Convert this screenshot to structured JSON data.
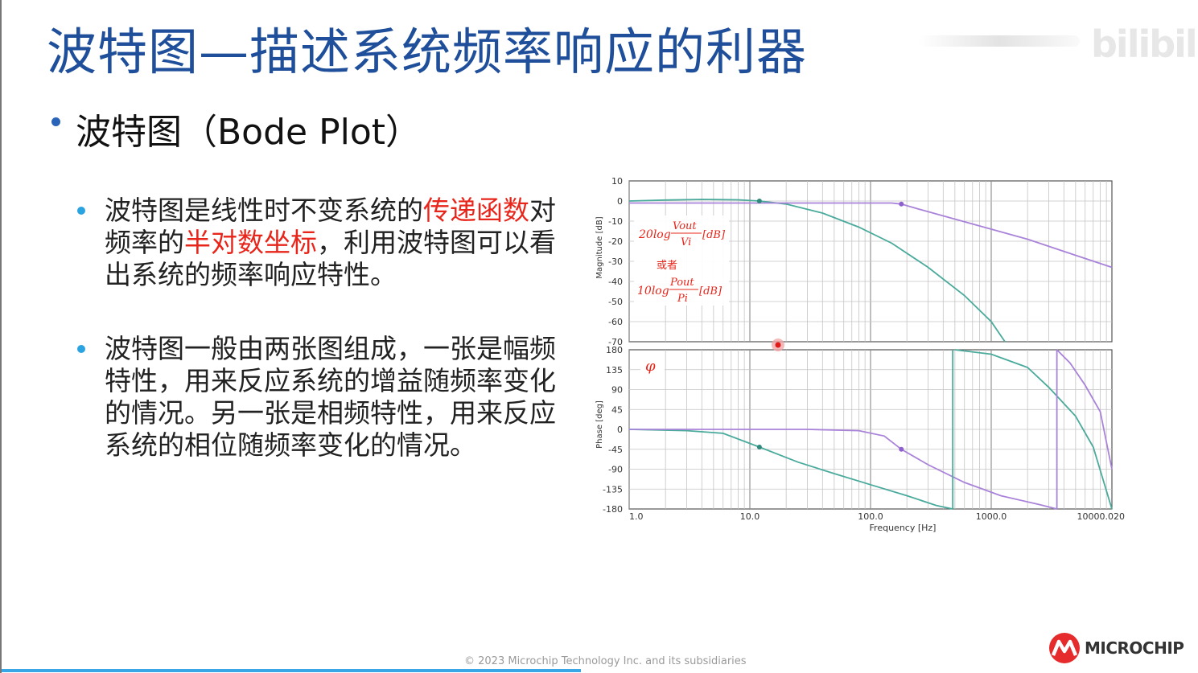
{
  "slide": {
    "title": "波特图—描述系统频率响应的利器",
    "watermark_logo": "bilibili",
    "subtitle": "波特图（Bode Plot）",
    "bullet1": {
      "part1": "波特图是线性时不变系统的",
      "part2": "传递函数",
      "part3": "对频率的",
      "part4": "半对数坐标",
      "part5": "，利用波特图可以看出系统的频率响应特性。"
    },
    "bullet2": "波特图一般由两张图组成，一张是幅频特性，用来反应系统的增益随频率变化的情况。另一张是相频特性，用来反应系统的相位随频率变化的情况。",
    "copyright": "© 2023 Microchip Technology Inc. and its subsidiaries",
    "brand": "MICROCHIP"
  },
  "colors": {
    "title": "#1f4f9a",
    "highlight": "#e8251a",
    "bullet_dot": "#2aa3e0",
    "series_teal": "#4aaa9c",
    "series_purple": "#a983d9",
    "brand_red": "#e52b2b"
  },
  "chart_data": {
    "type": "line",
    "xlabel": "Frequency [Hz]",
    "xscale": "log",
    "x_ticks": [
      "1.0",
      "10.0",
      "100.0",
      "1000.0",
      "10000.020"
    ],
    "xlim": [
      1,
      10000
    ],
    "magnitude": {
      "ylabel": "Magnitude [dB]",
      "ylim": [
        -70,
        10
      ],
      "y_ticks": [
        "10",
        "0",
        "-10",
        "-20",
        "-30",
        "-40",
        "-50",
        "-60",
        "-70"
      ],
      "annotation_1_prefix": "20log",
      "annotation_1_num": "Vout",
      "annotation_1_den": "Vi",
      "annotation_1_unit": "[dB]",
      "annotation_or": "或者",
      "annotation_2_prefix": "10log",
      "annotation_2_num": "Pout",
      "annotation_2_den": "Pi",
      "annotation_2_unit": "[dB]",
      "series": [
        {
          "x": [
            1,
            2,
            4,
            8,
            12,
            20,
            40,
            80,
            150,
            300,
            600,
            1000,
            1300
          ],
          "y": [
            0,
            0.5,
            0.8,
            0.6,
            0,
            -1.5,
            -6,
            -13,
            -21,
            -33,
            -47,
            -60,
            -70
          ]
        },
        {
          "x": [
            1,
            10,
            100,
            150,
            180,
            250,
            500,
            1000,
            2000,
            5000,
            10000
          ],
          "y": [
            -1,
            -1,
            -1,
            -1,
            -1.5,
            -4,
            -9,
            -14,
            -19,
            -27,
            -33
          ]
        }
      ],
      "markers": [
        {
          "x": 12,
          "y": 0
        },
        {
          "x": 180,
          "y": -1.5
        }
      ]
    },
    "phase": {
      "ylabel": "Phase [deg]",
      "symbol": "φ",
      "ylim": [
        -180,
        180
      ],
      "y_ticks": [
        "180",
        "135",
        "90",
        "45",
        "0",
        "-45",
        "-90",
        "-135",
        "-180"
      ],
      "series": [
        {
          "x": [
            1,
            3,
            6,
            12,
            25,
            50,
            100,
            200,
            350,
            480
          ],
          "y": [
            0,
            -3,
            -9,
            -40,
            -74,
            -100,
            -125,
            -150,
            -172,
            -180
          ]
        },
        {
          "x": [
            500,
            1000,
            2000,
            3000,
            5000,
            7000,
            10000
          ],
          "y": [
            180,
            170,
            140,
            95,
            30,
            -40,
            -180
          ]
        },
        {
          "x": [
            1,
            30,
            80,
            130,
            180,
            300,
            600,
            1200,
            2500,
            3500
          ],
          "y": [
            0,
            0,
            -3,
            -15,
            -45,
            -80,
            -120,
            -150,
            -170,
            -180
          ]
        },
        {
          "x": [
            3500,
            4500,
            6000,
            8000,
            10000
          ],
          "y": [
            180,
            150,
            100,
            40,
            -90
          ]
        }
      ],
      "markers": [
        {
          "x": 12,
          "y": -40
        },
        {
          "x": 180,
          "y": -45
        }
      ]
    }
  }
}
